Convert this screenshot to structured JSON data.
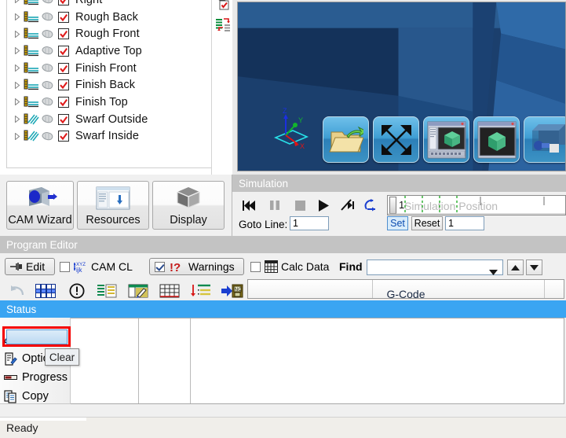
{
  "tree": {
    "items": [
      {
        "label": "Right",
        "icon": "toolpath-layers-icon",
        "checked": true,
        "partial": true
      },
      {
        "label": "Rough Back",
        "icon": "toolpath-layers-icon",
        "checked": true
      },
      {
        "label": "Rough Front",
        "icon": "toolpath-layers-icon",
        "checked": true
      },
      {
        "label": "Adaptive Top",
        "icon": "toolpath-layers-icon",
        "checked": true
      },
      {
        "label": "Finish Front",
        "icon": "toolpath-layers-icon",
        "checked": true
      },
      {
        "label": "Finish Back",
        "icon": "toolpath-layers-icon",
        "checked": true
      },
      {
        "label": "Finish Top",
        "icon": "toolpath-layers-icon",
        "checked": true
      },
      {
        "label": "Swarf Outside",
        "icon": "toolpath-swarf-icon",
        "checked": true
      },
      {
        "label": "Swarf Inside",
        "icon": "toolpath-swarf-icon",
        "checked": true
      }
    ]
  },
  "big_buttons": [
    {
      "label": "CAM Wizard",
      "icon": "cam-wizard-icon"
    },
    {
      "label": "Resources",
      "icon": "resources-icon"
    },
    {
      "label": "Display",
      "icon": "display-cube-icon"
    }
  ],
  "viewport": {
    "axis_labels": {
      "x": "X",
      "y": "Y",
      "z": "Z"
    },
    "buttons": [
      {
        "name": "open-folder-button",
        "icon": "folder-open-icon"
      },
      {
        "name": "fit-view-button",
        "icon": "fit-arrows-icon"
      },
      {
        "name": "show-window-cube-button",
        "icon": "window-cube-icon"
      },
      {
        "name": "show-cube-button",
        "icon": "cube-icon"
      },
      {
        "name": "tool-view-button",
        "icon": "tool-holder-icon"
      }
    ]
  },
  "simulation": {
    "title": "Simulation",
    "transport": [
      {
        "name": "rewind-button",
        "icon": "rewind-icon"
      },
      {
        "name": "pause-button",
        "icon": "pause-icon"
      },
      {
        "name": "stop-button",
        "icon": "stop-icon"
      },
      {
        "name": "play-button",
        "icon": "play-icon"
      },
      {
        "name": "step-button",
        "icon": "step-icon"
      },
      {
        "name": "loop-button",
        "icon": "loop-icon"
      }
    ],
    "slider_placeholder": "Simulation Position",
    "slider_value": "1",
    "goto_line_label": "Goto Line:",
    "goto_line_value": "1",
    "set_label": "Set",
    "reset_label": "Reset",
    "reset_value": "1"
  },
  "program_editor": {
    "title": "Program Editor",
    "edit_label": "Edit",
    "cam_cl_label": "CAM CL",
    "cam_cl_checked": false,
    "warnings_label": "Warnings",
    "warnings_checked": true,
    "calc_data_label": "Calc Data",
    "calc_data_checked": false,
    "find_label": "Find",
    "find_value": "",
    "gcode_label": "G-Code",
    "tool_icons": [
      "undo-icon",
      "registers-icon",
      "alert-circle-icon",
      "list-lines-icon",
      "table-edit-icon",
      "table-grid-icon",
      "insert-line-icon",
      "export-nc-icon"
    ]
  },
  "status": {
    "title": "Status",
    "menu": [
      {
        "label": "Clear",
        "icon": "eraser-icon",
        "selected": true
      },
      {
        "label": "Options",
        "icon": "options-doc-icon",
        "selected": false
      },
      {
        "label": "Progress",
        "icon": "progress-bar-icon",
        "selected": false
      },
      {
        "label": "Copy",
        "icon": "copy-icon",
        "selected": false
      }
    ],
    "tooltip": "Clear"
  },
  "statusbar": {
    "text": "Ready"
  },
  "colors": {
    "status_title_bg": "#3aa5f2",
    "panel_title_bg": "#c3c3c3",
    "highlight_red": "#f40000",
    "viewport_bg": "#1d4675",
    "checkbox_red": "#e01b1b"
  }
}
